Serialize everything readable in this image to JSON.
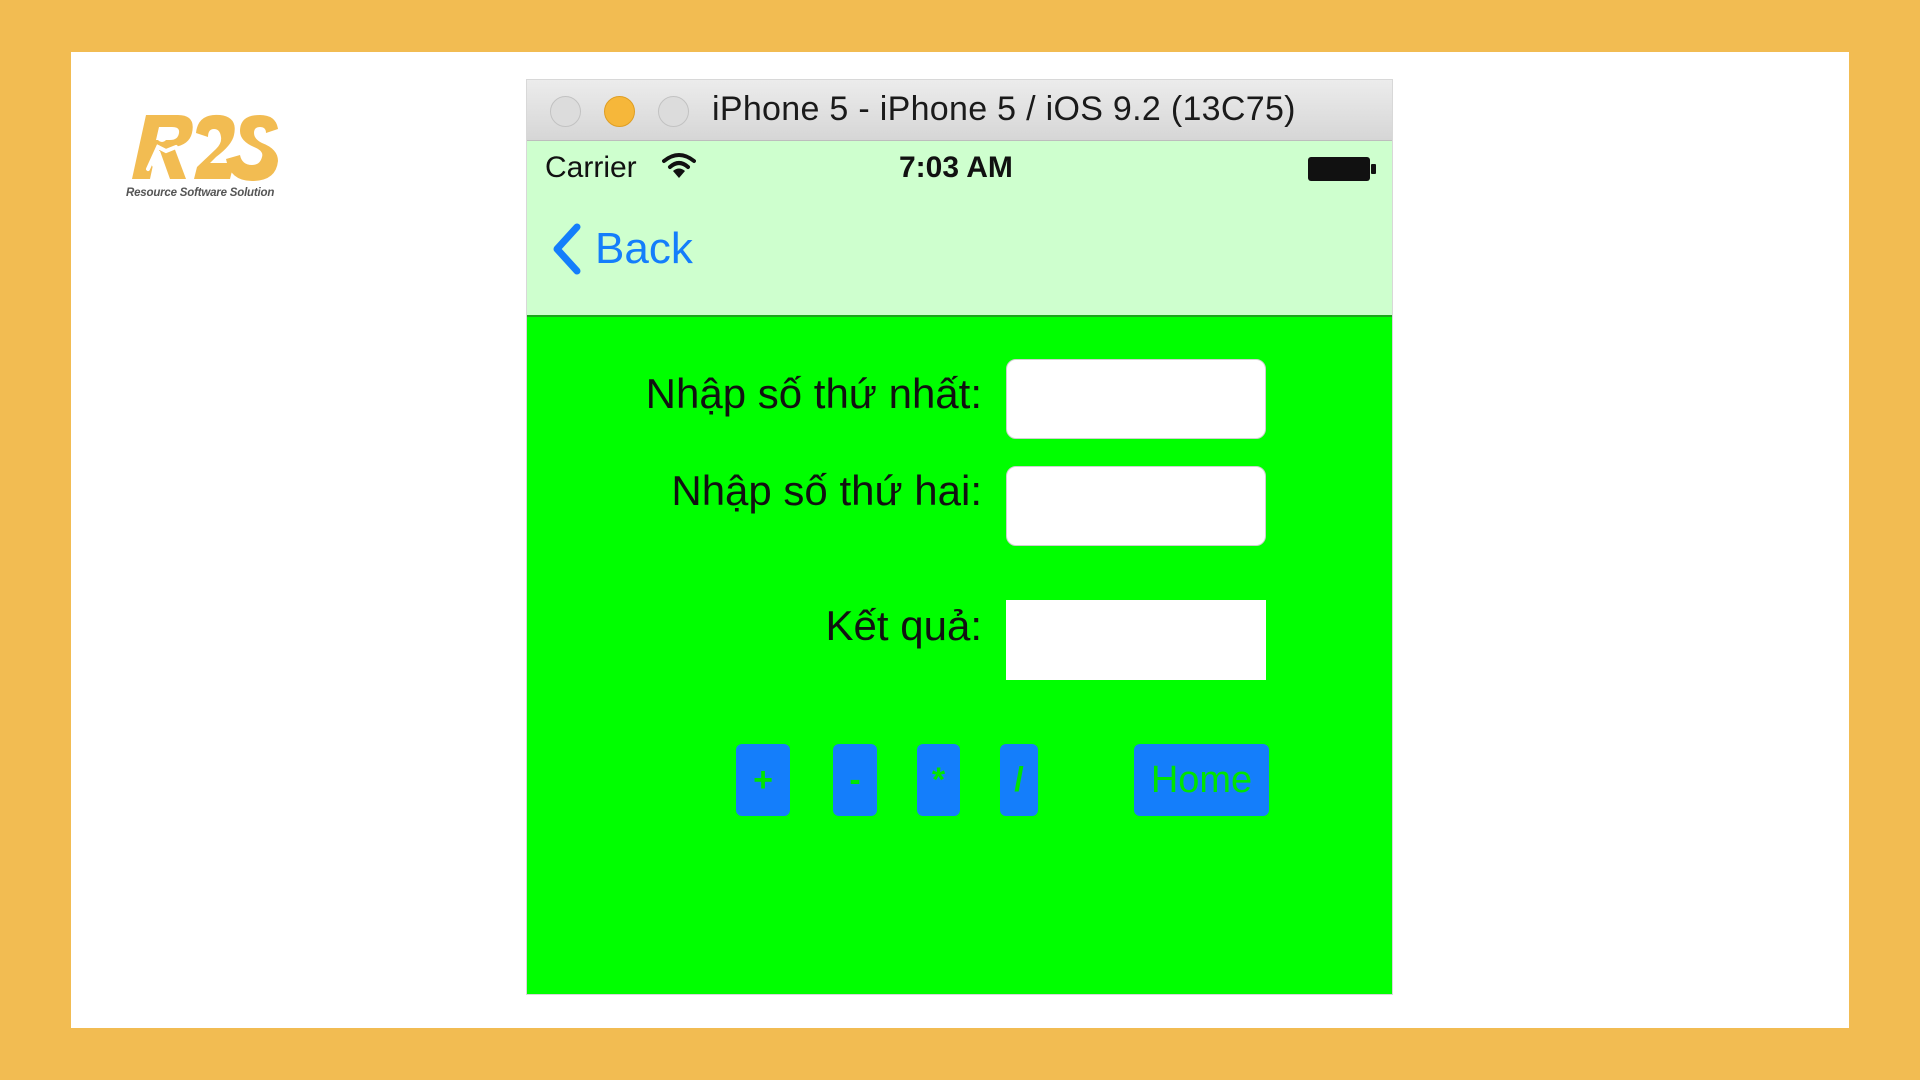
{
  "logo": {
    "text": "R2S",
    "tagline": "Resource Software Solution",
    "brand_color": "#f2bc52"
  },
  "simulator": {
    "window_title": "iPhone 5 - iPhone 5 / iOS 9.2 (13C75)",
    "status_bar": {
      "carrier": "Carrier",
      "time": "7:03 AM",
      "wifi_icon": "wifi-icon",
      "battery_icon": "battery-icon"
    },
    "nav": {
      "back_label": "Back",
      "back_icon": "chevron-left-icon",
      "background": "#ceffce"
    },
    "form": {
      "first_label": "Nhập số thứ nhất:",
      "first_value": "",
      "second_label": "Nhập số thứ hai:",
      "second_value": "",
      "result_label": "Kết quả:",
      "result_value": ""
    },
    "buttons": {
      "add": "+",
      "subtract": "-",
      "multiply": "*",
      "divide": "/",
      "home": "Home"
    },
    "colors": {
      "content_background": "#00ff00",
      "button_background": "#147efb",
      "button_text": "#00e400"
    }
  }
}
